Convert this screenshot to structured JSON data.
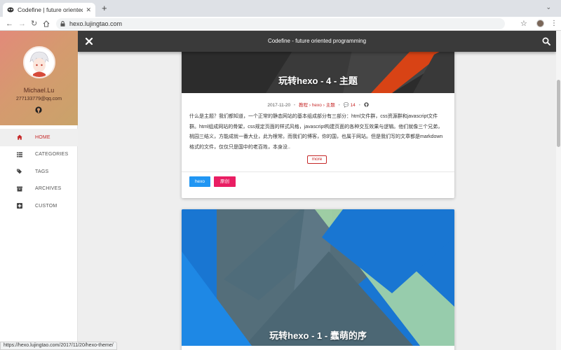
{
  "browser": {
    "tab_title": "Codefine | future oriented prog",
    "tab_close": "✕",
    "new_tab": "+",
    "url": "hexo.lujingtao.com",
    "status_url": "https://hexo.lujingtao.com/2017/11/20/hexo-theme/"
  },
  "sidebar": {
    "author": "Michael.Lu",
    "email": "277133779@qq.com",
    "items": [
      {
        "label": "HOME",
        "icon": "home-icon",
        "active": true
      },
      {
        "label": "CATEGORIES",
        "icon": "list-icon",
        "active": false
      },
      {
        "label": "TAGS",
        "icon": "tags-icon",
        "active": false
      },
      {
        "label": "ARCHIVES",
        "icon": "archive-icon",
        "active": false
      },
      {
        "label": "CUSTOM",
        "icon": "plus-square-icon",
        "active": false
      }
    ]
  },
  "header": {
    "site_title": "Codefine - future oriented programming"
  },
  "posts": [
    {
      "title": "玩转hexo - 4 - 主题",
      "date": "2017-11-20",
      "category_1": "教程",
      "category_2": "hexo",
      "category_3": "主题",
      "comment_count": "14",
      "excerpt": "什么是主题？我们都知道，一个正常的静态网站的基本组成部分有三部分：html文件群，css资源群和javascript文件群。html组成网站的骨架，css规定页面的样式风格，javascript构建页面的各种交互效果与逻辑。他们就像三个兄弟，桃园三结义，方能成就一番大业，此为根常。而我们的博客，你的国，也属于网站。但是我们写的文章都是markdown格式的文件，仅仅只是国中的老百姓，本身没..",
      "more": "more",
      "tags": [
        "hexo",
        "原创"
      ]
    },
    {
      "title": "玩转hexo - 1 - 蠢萌的序"
    }
  ],
  "colors": {
    "accent": "#c62828",
    "appbar": "#3a3a3a",
    "tag_hexo": "#2196f3",
    "tag_original": "#e91e63"
  }
}
